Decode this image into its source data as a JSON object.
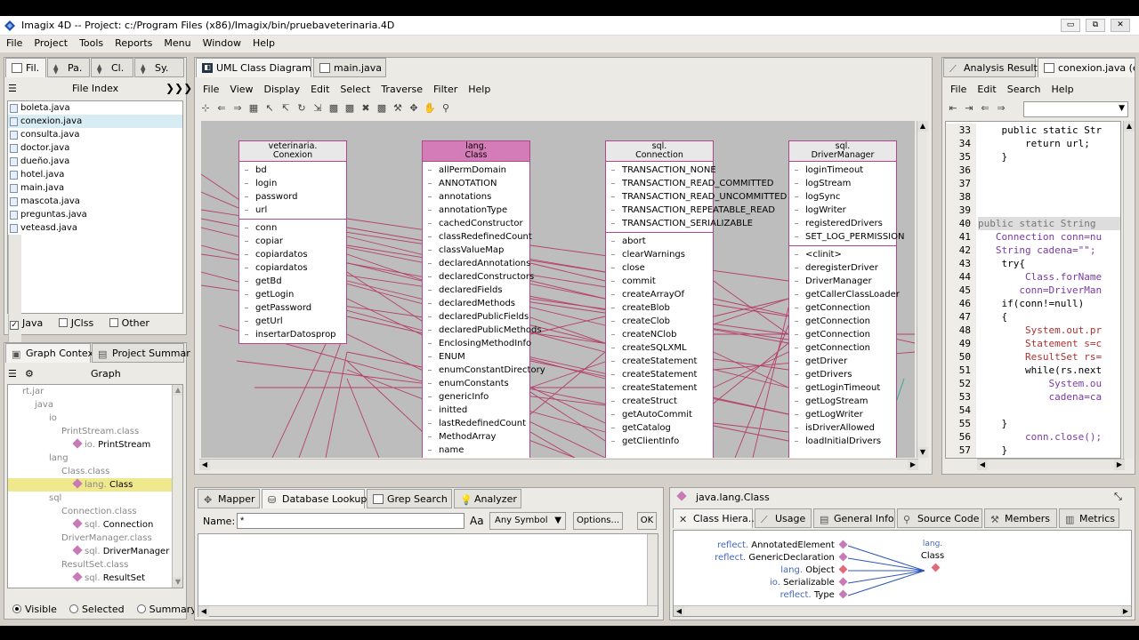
{
  "window": {
    "title": "Imagix 4D  --  Project: c:/Program Files (x86)/Imagix/bin/pruebaveterinaria.4D",
    "min": "▭",
    "max": "⧉",
    "close": "✕"
  },
  "menubar": [
    "File",
    "Project",
    "Tools",
    "Reports",
    "Menu",
    "Window",
    "Help"
  ],
  "left_tabs": [
    "Fil.",
    "Pa.",
    "Cl.",
    "Sy."
  ],
  "file_index": {
    "title": "File Index",
    "expand": "❯❯❯",
    "files": [
      "boleta.java",
      "conexion.java",
      "consulta.java",
      "doctor.java",
      "dueño.java",
      "hotel.java",
      "main.java",
      "mascota.java",
      "preguntas.java",
      "veteasd.java"
    ],
    "filters": [
      "Java",
      "JClss",
      "Other"
    ]
  },
  "graph_panel": {
    "tabs": [
      "Graph Contex",
      "Project Summar"
    ],
    "title": "Graph",
    "tree": [
      {
        "pre": "",
        "text": "rt.jar"
      },
      {
        "pre": "",
        "text": "java"
      },
      {
        "pre": "",
        "text": "io"
      },
      {
        "pre": "",
        "text": "PrintStream.class"
      },
      {
        "pre": "io.",
        "text": "PrintStream"
      },
      {
        "pre": "",
        "text": "lang"
      },
      {
        "pre": "",
        "text": "Class.class"
      },
      {
        "pre": "lang.",
        "text": "Class"
      },
      {
        "pre": "",
        "text": "sql"
      },
      {
        "pre": "",
        "text": "Connection.class"
      },
      {
        "pre": "sql.",
        "text": "Connection"
      },
      {
        "pre": "",
        "text": "DriverManager.class"
      },
      {
        "pre": "sql.",
        "text": "DriverManager"
      },
      {
        "pre": "",
        "text": "ResultSet.class"
      },
      {
        "pre": "sql.",
        "text": "ResultSet"
      }
    ],
    "radios": [
      "Visible",
      "Selected",
      "Summary"
    ]
  },
  "center_tabs": [
    "UML Class Diagram",
    "main.java"
  ],
  "center_menu": [
    "File",
    "View",
    "Display",
    "Edit",
    "Select",
    "Traverse",
    "Filter",
    "Help"
  ],
  "uml": {
    "classes": [
      {
        "pkg": "veterinaria.",
        "name": "Conexion",
        "head": "plain",
        "fields": [
          "bd",
          "login",
          "password",
          "url"
        ],
        "methods": [
          "conn",
          "copiar",
          "copiardatos",
          "copiardatos",
          "getBd",
          "getLogin",
          "getPassword",
          "getUrl",
          "insertarDatosprop"
        ]
      },
      {
        "pkg": "lang.",
        "name": "Class",
        "head": "pink",
        "fields": [
          "allPermDomain",
          "ANNOTATION",
          "annotations",
          "annotationType",
          "cachedConstructor",
          "classRedefinedCount",
          "classValueMap",
          "declaredAnnotations",
          "declaredConstructors",
          "declaredFields",
          "declaredMethods",
          "declaredPublicFields",
          "declaredPublicMethods",
          "EnclosingMethodInfo",
          "ENUM",
          "enumConstantDirectory",
          "enumConstants",
          "genericInfo",
          "initted",
          "lastRedefinedCount",
          "MethodArray",
          "name"
        ],
        "methods": []
      },
      {
        "pkg": "sql.",
        "name": "Connection",
        "head": "plain",
        "fields": [
          "TRANSACTION_NONE",
          "TRANSACTION_READ_COMMITTED",
          "TRANSACTION_READ_UNCOMMITTED",
          "TRANSACTION_REPEATABLE_READ",
          "TRANSACTION_SERIALIZABLE"
        ],
        "methods": [
          "abort",
          "clearWarnings",
          "close",
          "commit",
          "createArrayOf",
          "createBlob",
          "createClob",
          "createNClob",
          "createSQLXML",
          "createStatement",
          "createStatement",
          "createStatement",
          "createStruct",
          "getAutoCommit",
          "getCatalog",
          "getClientInfo"
        ]
      },
      {
        "pkg": "sql.",
        "name": "DriverManager",
        "head": "plain",
        "fields": [
          "loginTimeout",
          "logStream",
          "logSync",
          "logWriter",
          "registeredDrivers",
          "SET_LOG_PERMISSION"
        ],
        "methods": [
          "<clinit>",
          "deregisterDriver",
          "DriverManager",
          "getCallerClassLoader",
          "getConnection",
          "getConnection",
          "getConnection",
          "getConnection",
          "getDriver",
          "getDrivers",
          "getLoginTimeout",
          "getLogStream",
          "getLogWriter",
          "isDriverAllowed",
          "loadInitialDrivers"
        ]
      }
    ]
  },
  "bottom_center": {
    "tabs": [
      "Mapper",
      "Database Lookup",
      "Grep Search",
      "Analyzer"
    ],
    "name_label": "Name:",
    "name_value": "*",
    "case_label": "Aa",
    "symbol_select": "Any Symbol",
    "options": "Options...",
    "ok": "OK"
  },
  "right_tabs": [
    "Analysis Results",
    "conexion.java (e."
  ],
  "right_menu": [
    "File",
    "Edit",
    "Search",
    "Help"
  ],
  "code": {
    "lines": [
      "33",
      "34",
      "35",
      "36",
      "37",
      "38",
      "39",
      "40",
      "41",
      "42",
      "43",
      "44",
      "45",
      "46",
      "47",
      "48",
      "49",
      "50",
      "51",
      "52",
      "53",
      "54",
      "55",
      "56",
      "57"
    ],
    "text": [
      "    public static Str",
      "        return url;",
      "    }",
      "",
      "",
      "",
      "",
      "public static String",
      "   Connection conn=nu",
      "   String cadena=\"\";",
      "    try{",
      "        Class.forName",
      "       conn=DriverMan",
      "    if(conn!=null)",
      "    {",
      "        System.out.pr",
      "        Statement s=c",
      "        ResultSet rs=",
      "        while(rs.next",
      "            System.ou",
      "            cadena=ca",
      "",
      "    }",
      "        conn.close();",
      "    }"
    ]
  },
  "class_info": {
    "title": "java.lang.Class",
    "tabs": [
      "Class Hiera..",
      "Usage",
      "General Info",
      "Source Code",
      "Members",
      "Metrics"
    ],
    "supers": [
      {
        "pre": "reflect.",
        "name": "AnnotatedElement"
      },
      {
        "pre": "reflect.",
        "name": "GenericDeclaration"
      },
      {
        "pre": "lang.",
        "name": "Object"
      },
      {
        "pre": "io.",
        "name": "Serializable"
      },
      {
        "pre": "reflect.",
        "name": "Type"
      }
    ],
    "target_pkg": "lang.",
    "target_name": "Class"
  },
  "colors": {
    "uml_border": "#b0488a",
    "uml_pink": "#d47cb8",
    "edge": "#b5406a",
    "canvas_bg": "#bdbdbd",
    "selection": "#f0e88c"
  }
}
